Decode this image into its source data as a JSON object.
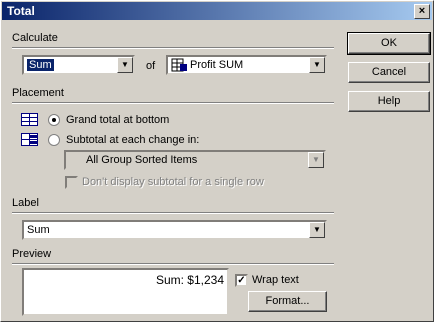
{
  "window": {
    "title": "Total",
    "close_glyph": "×"
  },
  "buttons": {
    "ok": "OK",
    "cancel": "Cancel",
    "help": "Help",
    "format": "Format..."
  },
  "calculate": {
    "label": "Calculate",
    "function_value": "Sum",
    "of_label": "of",
    "field_value": "Profit SUM",
    "field_icon": "table-field-icon"
  },
  "placement": {
    "label": "Placement",
    "grand_total_label": "Grand total at bottom",
    "subtotal_label": "Subtotal at each change in:",
    "subtotal_group_value": "All Group Sorted Items",
    "dont_display_label": "Don't display subtotal for a single row",
    "grand_total_selected": true
  },
  "label_section": {
    "label": "Label",
    "value": "Sum"
  },
  "preview_section": {
    "label": "Preview",
    "text": "Sum: $1,234",
    "wrap_text_label": "Wrap text",
    "wrap_text_checked": true
  },
  "colors": {
    "face": "#d4d0c8",
    "title_start": "#0a246a",
    "title_end": "#a6caf0",
    "selection": "#0a246a"
  }
}
